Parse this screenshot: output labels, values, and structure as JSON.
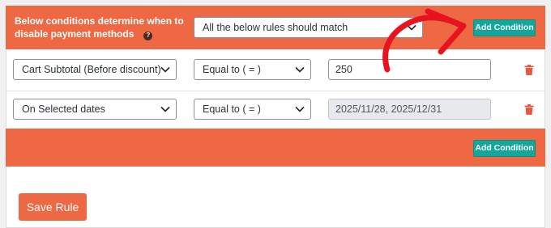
{
  "header": {
    "title": "Below conditions determine when to disable payment methods",
    "match_select": "All the below rules should match",
    "add_condition_label": "Add Condition"
  },
  "rules": [
    {
      "condition": "Cart Subtotal (Before discount)",
      "operator": "Equal to ( = )",
      "value": "250",
      "disabled": false
    },
    {
      "condition": "On Selected dates",
      "operator": "Equal to ( = )",
      "value": "2025/11/28, 2025/12/31",
      "disabled": true
    }
  ],
  "footer": {
    "add_condition_label": "Add Condition"
  },
  "save_label": "Save Rule",
  "colors": {
    "accent": "#ee6843",
    "teal": "#12a79a",
    "arrow": "#e8131f"
  },
  "icons": {
    "help": "question-circle-icon",
    "trash": "trash-icon",
    "chevron": "chevron-down-icon"
  }
}
